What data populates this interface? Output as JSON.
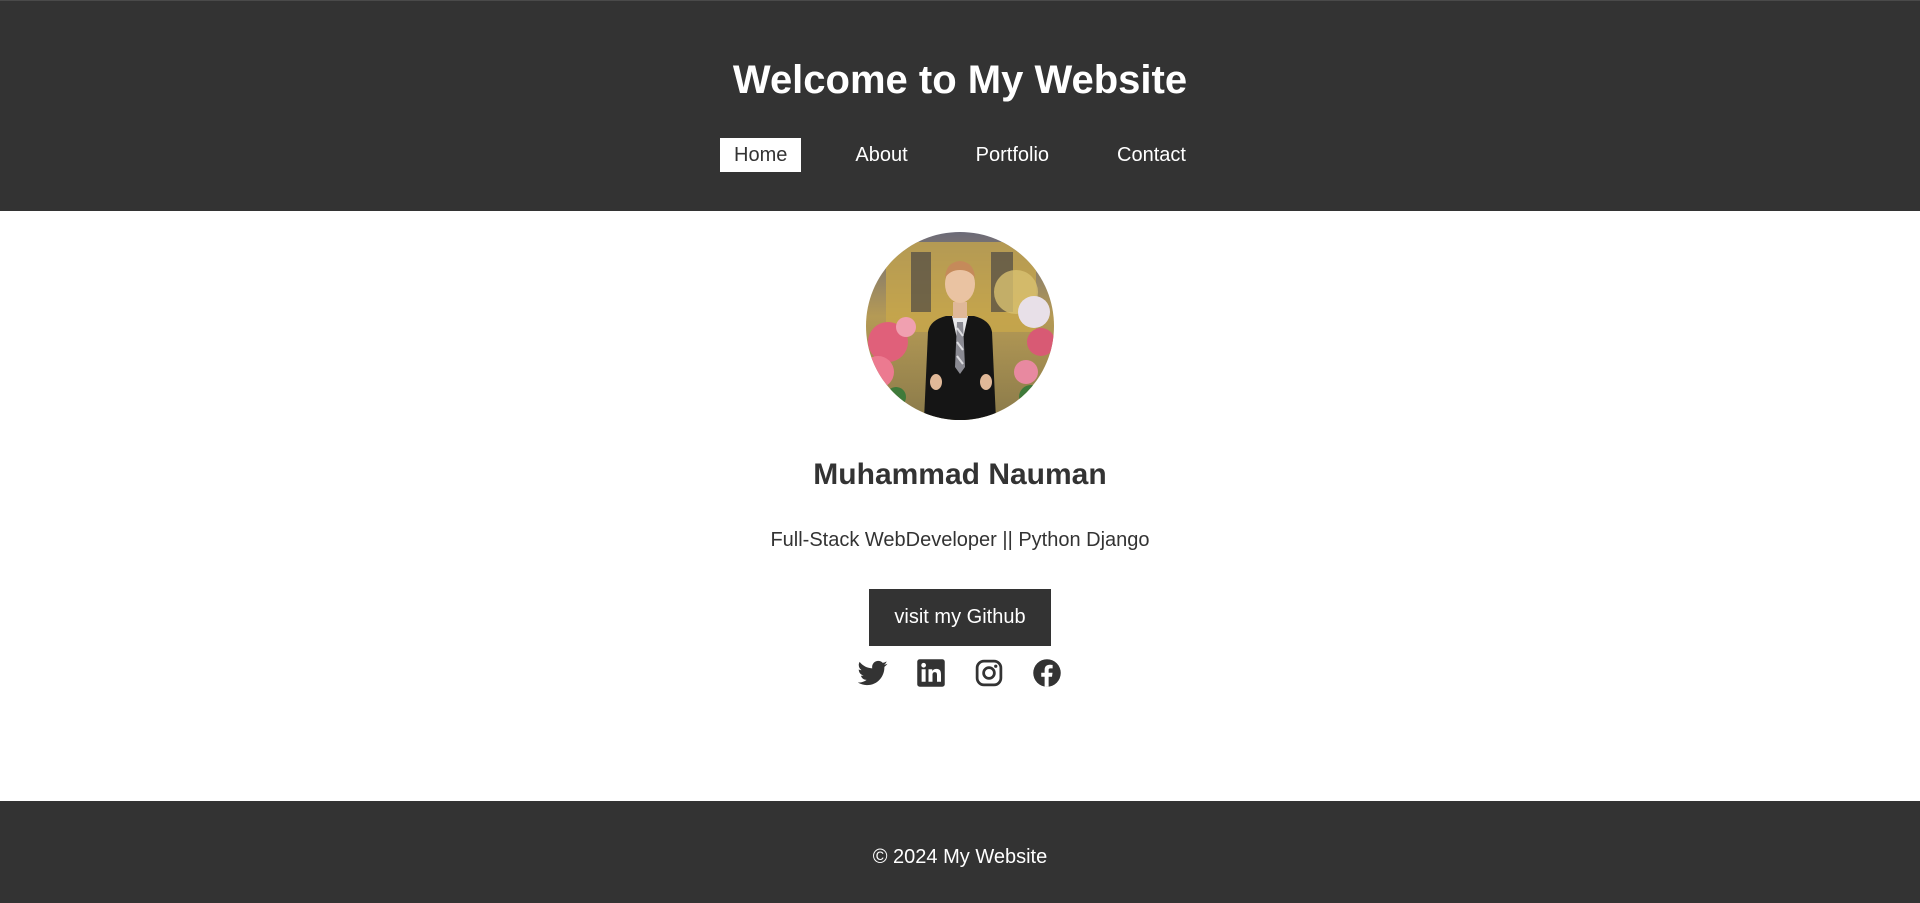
{
  "header": {
    "title": "Welcome to My Website",
    "nav": [
      {
        "label": "Home",
        "active": true
      },
      {
        "label": "About",
        "active": false
      },
      {
        "label": "Portfolio",
        "active": false
      },
      {
        "label": "Contact",
        "active": false
      }
    ]
  },
  "profile": {
    "name": "Muhammad Nauman",
    "role": "Full-Stack WebDeveloper || Python Django",
    "github_button": "visit my Github",
    "social_icons": [
      "twitter-icon",
      "linkedin-icon",
      "instagram-icon",
      "facebook-icon"
    ]
  },
  "footer": {
    "copyright": "© 2024 My Website"
  },
  "colors": {
    "dark": "#333333",
    "light": "#ffffff"
  }
}
